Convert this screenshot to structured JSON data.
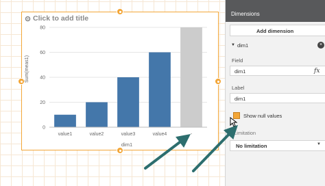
{
  "chart": {
    "title": "Click to add title",
    "ylabel": "Sum(meas1)",
    "xlabel": "dim1"
  },
  "chart_data": {
    "type": "bar",
    "categories": [
      "value1",
      "value2",
      "value3",
      "value4",
      "-"
    ],
    "values": [
      10,
      20,
      40,
      60,
      80
    ],
    "null_category_color": "#cccccc",
    "bar_color": "#4477aa",
    "yticks": [
      "0",
      "20",
      "40",
      "60",
      "80"
    ],
    "ylim": [
      0,
      80
    ],
    "ylabel": "Sum(meas1)",
    "xlabel": "dim1",
    "grid": true
  },
  "panel": {
    "header_title": "Dimensions",
    "add_dimension_label": "Add dimension",
    "dimension_name": "dim1",
    "field_label": "Field",
    "field_value": "dim1",
    "label_label": "Label",
    "label_value": "dim1",
    "show_null_label": "Show null values",
    "show_null_checked": true,
    "limitation_label": "Limitation",
    "limitation_value": "No limitation"
  },
  "colors": {
    "accent": "#f3a637",
    "panel_header": "#58595b",
    "arrow": "#2d6e6e"
  }
}
